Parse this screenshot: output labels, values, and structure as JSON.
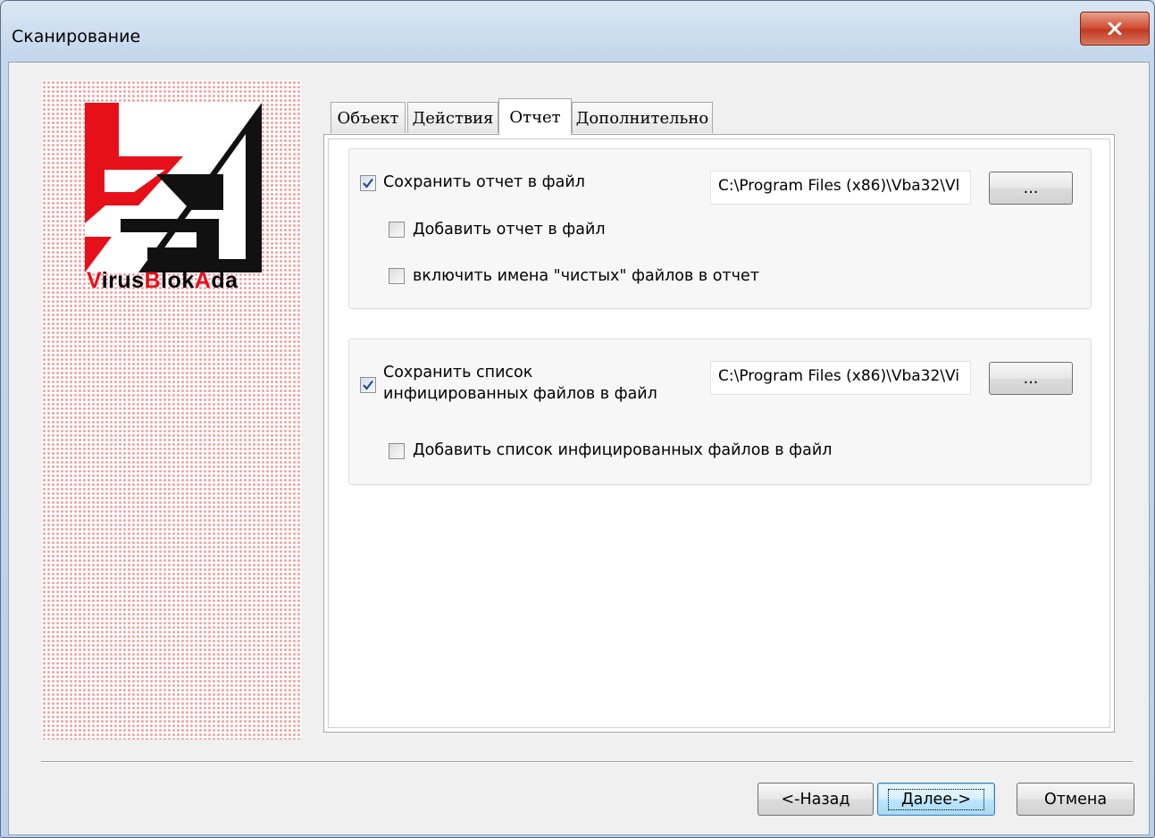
{
  "window": {
    "title": "Сканирование",
    "close_icon": "close-x-icon"
  },
  "brand": {
    "logo_icon": "vba32-logo",
    "name_parts": [
      {
        "text": "V",
        "color": "#e6101a"
      },
      {
        "text": "irus",
        "color": "#000000"
      },
      {
        "text": "B",
        "color": "#e6101a"
      },
      {
        "text": "lok",
        "color": "#000000"
      },
      {
        "text": "A",
        "color": "#e6101a"
      },
      {
        "text": "da",
        "color": "#000000"
      }
    ]
  },
  "tabs": [
    {
      "label": "Объект",
      "active": false
    },
    {
      "label": "Действия",
      "active": false
    },
    {
      "label": "Отчет",
      "active": true
    },
    {
      "label": "Дополнительно",
      "active": false
    }
  ],
  "report_group": {
    "save_report": {
      "label": "Сохранить отчет в файл",
      "checked": true
    },
    "report_path": "C:\\Program Files (x86)\\Vba32\\Vl",
    "browse_label": "...",
    "append_report": {
      "label": "Добавить отчет в файл",
      "checked": false
    },
    "include_clean": {
      "label": "включить имена \"чистых\" файлов в отчет",
      "checked": false
    }
  },
  "infected_group": {
    "save_list": {
      "label_line1": "Сохранить список",
      "label_line2": "инфицированных файлов в файл",
      "checked": true
    },
    "list_path": "C:\\Program Files (x86)\\Vba32\\Vi",
    "browse_label": "...",
    "append_list": {
      "label": "Добавить список инфицированных файлов в файл",
      "checked": false
    }
  },
  "footer": {
    "back_label": "<-Назад",
    "next_label": "Далее->",
    "cancel_label": "Отмена"
  },
  "colors": {
    "accent_red": "#e6101a",
    "title_bar": "#c4d7ec",
    "close_button": "#c23a22",
    "default_button_border": "#3c7fb1"
  }
}
